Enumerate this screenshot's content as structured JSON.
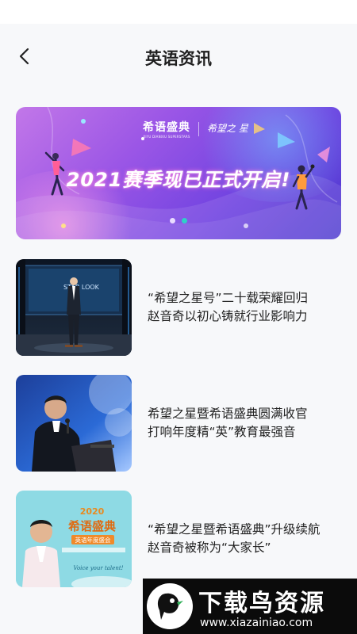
{
  "header": {
    "title": "英语资讯"
  },
  "banner": {
    "logo_left": "希语盛典",
    "logo_left_sub": "XIYU DIANXIU SUPERSTARS",
    "logo_right": "希望之 星",
    "headline": "2021赛季现已正式开启!",
    "slides_total": 2,
    "active_slide": 2
  },
  "articles": [
    {
      "line1": "“希望之星号”二十载荣耀回归",
      "line2": "赵音奇以初心铸就行业影响力",
      "thumb_text": "STAR   LOOK"
    },
    {
      "line1": "希望之星暨希语盛典圆满收官",
      "line2": "打响年度精“英”教育最强音",
      "thumb_text": ""
    },
    {
      "line1": "“希望之星暨希语盛典”升级续航",
      "line2": "赵音奇被称为“大家长”",
      "thumb_text_1": "2020",
      "thumb_text_2": "希语盛典",
      "thumb_text_3": "英语年度盛会",
      "thumb_text_4": "Voice your talent!"
    }
  ],
  "watermark": {
    "title": "下载鸟资源",
    "url": "www.xiazainiao.com"
  }
}
